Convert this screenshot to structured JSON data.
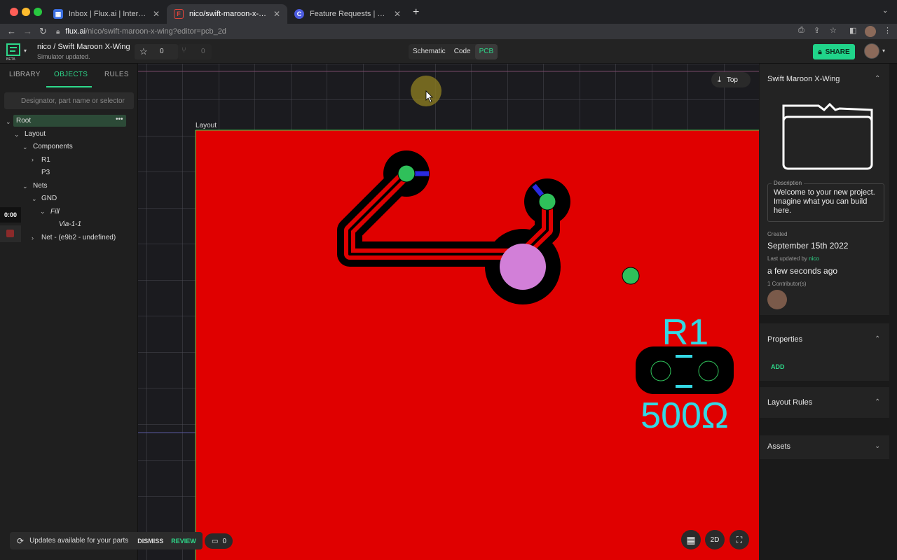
{
  "browser": {
    "tabs": [
      {
        "title": "Inbox | Flux.ai | Intercom",
        "favicon": "intercom-icon",
        "color": "#3b6fe0"
      },
      {
        "title": "nico/swift-maroon-x-wing: Wel",
        "favicon": "flux-icon",
        "color": "#e0453b"
      },
      {
        "title": "Feature Requests | Flux",
        "favicon": "canny-icon",
        "color": "#4c5ce0"
      }
    ],
    "new_tab": "+",
    "url_host": "flux.ai",
    "url_path": "/nico/swift-maroon-x-wing?editor=pcb_2d"
  },
  "header": {
    "logo_badge": "BETA",
    "breadcrumb": "nico / Swift Maroon X-Wing",
    "status": "Simulator updated.",
    "star_count": "0",
    "fork_count": "0",
    "modes": [
      "Schematic",
      "Code",
      "PCB"
    ],
    "active_mode": "PCB",
    "share_label": "SHARE"
  },
  "left": {
    "tabs": [
      "LIBRARY",
      "OBJECTS",
      "RULES"
    ],
    "active_tab": "OBJECTS",
    "search_placeholder": "Designator, part name or selector",
    "tree": {
      "root": "Root",
      "layout": "Layout",
      "components": "Components",
      "r1": "R1",
      "p3": "P3",
      "nets": "Nets",
      "gnd": "GND",
      "fill": "Fill",
      "via": "Via-1-1",
      "net_undefined": "Net - (e9b2 - undefined)"
    },
    "timer": "0:00"
  },
  "canvas": {
    "layout_label": "Layout",
    "view_label": "Top",
    "designator": "R1",
    "value": "500Ω",
    "view_2d": "2D",
    "colors": {
      "board": "#e00000",
      "pad": "#2fc05a",
      "via": "#d27fd8",
      "trace": "#000000",
      "silk": "#33d8e4"
    }
  },
  "right": {
    "project_title": "Swift Maroon X-Wing",
    "description_label": "Description",
    "description": "Welcome to your new project. Imagine what you can build here.",
    "created_label": "Created",
    "created": "September 15th 2022",
    "updated_label": "Last updated by",
    "updated_by": "nico",
    "updated": "a few seconds ago",
    "contributors": "1 Contributor(s)",
    "properties": "Properties",
    "add_label": "ADD",
    "layout_rules": "Layout Rules",
    "assets": "Assets"
  },
  "toast": {
    "message": "Updates available for your parts",
    "dismiss": "DISMISS",
    "review": "REVIEW",
    "comments": "0"
  }
}
